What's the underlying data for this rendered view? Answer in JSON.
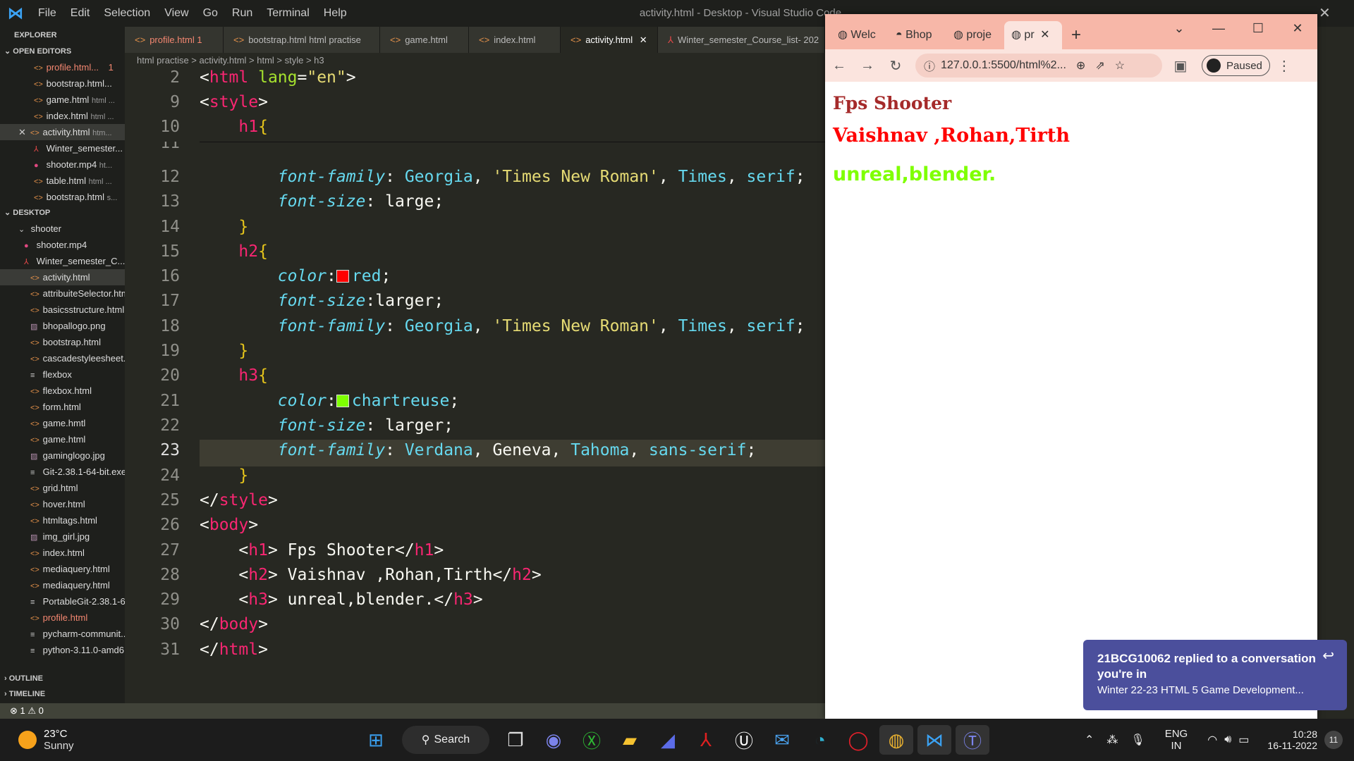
{
  "vscode": {
    "title": "activity.html - Desktop - Visual Studio Code",
    "menu": [
      "File",
      "Edit",
      "Selection",
      "View",
      "Go",
      "Run",
      "Terminal",
      "Help"
    ],
    "explorer_label": "EXPLORER",
    "open_editors_label": "OPEN EDITORS",
    "open_editors": [
      {
        "name": "profile.html...",
        "badge": "1"
      },
      {
        "name": "bootstrap.html...",
        "badge": ""
      },
      {
        "name": "game.html",
        "detail": "html ..."
      },
      {
        "name": "index.html",
        "detail": "html ..."
      },
      {
        "name": "activity.html",
        "detail": "htm..."
      },
      {
        "name": "Winter_semester...",
        "detail": ""
      },
      {
        "name": "shooter.mp4",
        "detail": "ht..."
      },
      {
        "name": "table.html",
        "detail": "html ..."
      },
      {
        "name": "bootstrap.html",
        "detail": "s..."
      }
    ],
    "desktop_label": "DESKTOP",
    "desktop_files": [
      "shooter",
      "shooter.mp4",
      "Winter_semester_C...",
      "activity.html",
      "attribuiteSelector.html",
      "basicsstructure.html",
      "bhopallogo.png",
      "bootstrap.html",
      "cascadestyleesheet.....",
      "flexbox",
      "flexbox.html",
      "form.html",
      "game.hmtl",
      "game.html",
      "gaminglogo.jpg",
      "Git-2.38.1-64-bit.exe",
      "grid.html",
      "hover.html",
      "htmltags.html",
      "img_girl.jpg",
      "index.html",
      "mediaquery.html",
      "mediaquery.html",
      "PortableGit-2.38.1-6...",
      "profile.html",
      "pycharm-communit...",
      "python-3.11.0-amd6..."
    ],
    "outline_label": "OUTLINE",
    "timeline_label": "TIMELINE",
    "tabs": [
      "profile.html 1",
      "bootstrap.html html practise",
      "game.html",
      "index.html",
      "activity.html",
      "Winter_semester_Course_list- 202"
    ],
    "breadcrumbs": "html practise > activity.html > html > style > h3",
    "status": "⊗ 1 ⚠ 0"
  },
  "browser": {
    "tabs": [
      "Welc",
      "Bhop",
      "proje",
      "pr"
    ],
    "url": "127.0.0.1:5500/html%2...",
    "paused": "Paused",
    "h1": "Fps Shooter",
    "h2": "Vaishnav ,Rohan,Tirth",
    "h3": "unreal,blender."
  },
  "toast": {
    "title": "21BCG10062 replied to a conversation you're in",
    "body": "Winter 22-23 HTML 5 Game Development..."
  },
  "taskbar": {
    "weather_temp": "23°C",
    "weather_desc": "Sunny",
    "search": "Search",
    "lang1": "ENG",
    "lang2": "IN",
    "time": "10:28",
    "date": "16-11-2022",
    "notif_count": "11"
  }
}
